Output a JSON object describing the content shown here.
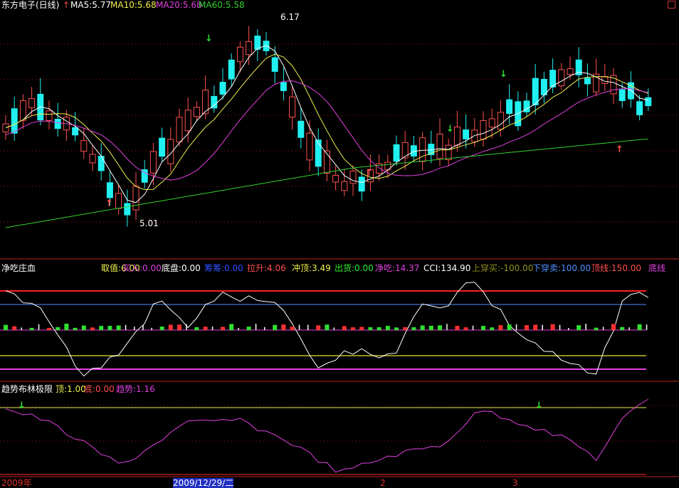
{
  "colors": {
    "up": "#ff5050",
    "down": "#20f0f0",
    "ma5": "#ffffff",
    "ma10": "#f0f050",
    "ma20": "#e040e0",
    "ma60": "#30d030",
    "grid": "#a01010",
    "bg": "#000000"
  },
  "main": {
    "title": "东方电子(日线)",
    "arrow_icon": "up-arrow-icon",
    "legends": [
      {
        "label": "MA5:5.77",
        "color": "#ffffff"
      },
      {
        "label": "MA10:5.68",
        "color": "#f0f050"
      },
      {
        "label": "MA20:5.68",
        "color": "#e040e0"
      },
      {
        "label": "MA60:5.58",
        "color": "#30d030"
      }
    ],
    "high_label": "6.17",
    "low_label": "5.01",
    "close_icon": "close-icon"
  },
  "indicator1": {
    "title": "净吃庄血",
    "items": [
      {
        "label": "取值:6.00",
        "color": "#f0f050"
      },
      {
        "label": "买入:0.00",
        "color": "#e040e0"
      },
      {
        "label": "底盘:0.00",
        "color": "#ffffff"
      },
      {
        "label": "筹筹:0.00",
        "color": "#3050ff"
      },
      {
        "label": "拉升:4.06",
        "color": "#ff5050"
      },
      {
        "label": "冲顶:3.49",
        "color": "#f0f050"
      },
      {
        "label": "出货:0.00",
        "color": "#30f030"
      },
      {
        "label": "净吃:14.37",
        "color": "#e040e0"
      },
      {
        "label": "CCI:134.90",
        "color": "#ffffff"
      },
      {
        "label": "上穿买:-100.00",
        "color": "#909020"
      },
      {
        "label": "下穿卖:100.00",
        "color": "#5090ff"
      },
      {
        "label": "顶线:150.00",
        "color": "#ff5050"
      },
      {
        "label": "底线",
        "color": "#e040e0"
      }
    ]
  },
  "indicator2": {
    "title": "趋势布林极限",
    "items": [
      {
        "label": "顶:1.00",
        "color": "#f0f050"
      },
      {
        "label": "底:0.00",
        "color": "#ff5050"
      },
      {
        "label": "趋势:1.16",
        "color": "#e040e0"
      }
    ]
  },
  "xaxis": {
    "labels": [
      "2009年",
      "2009/12/29/二",
      "2",
      "3"
    ]
  }
}
